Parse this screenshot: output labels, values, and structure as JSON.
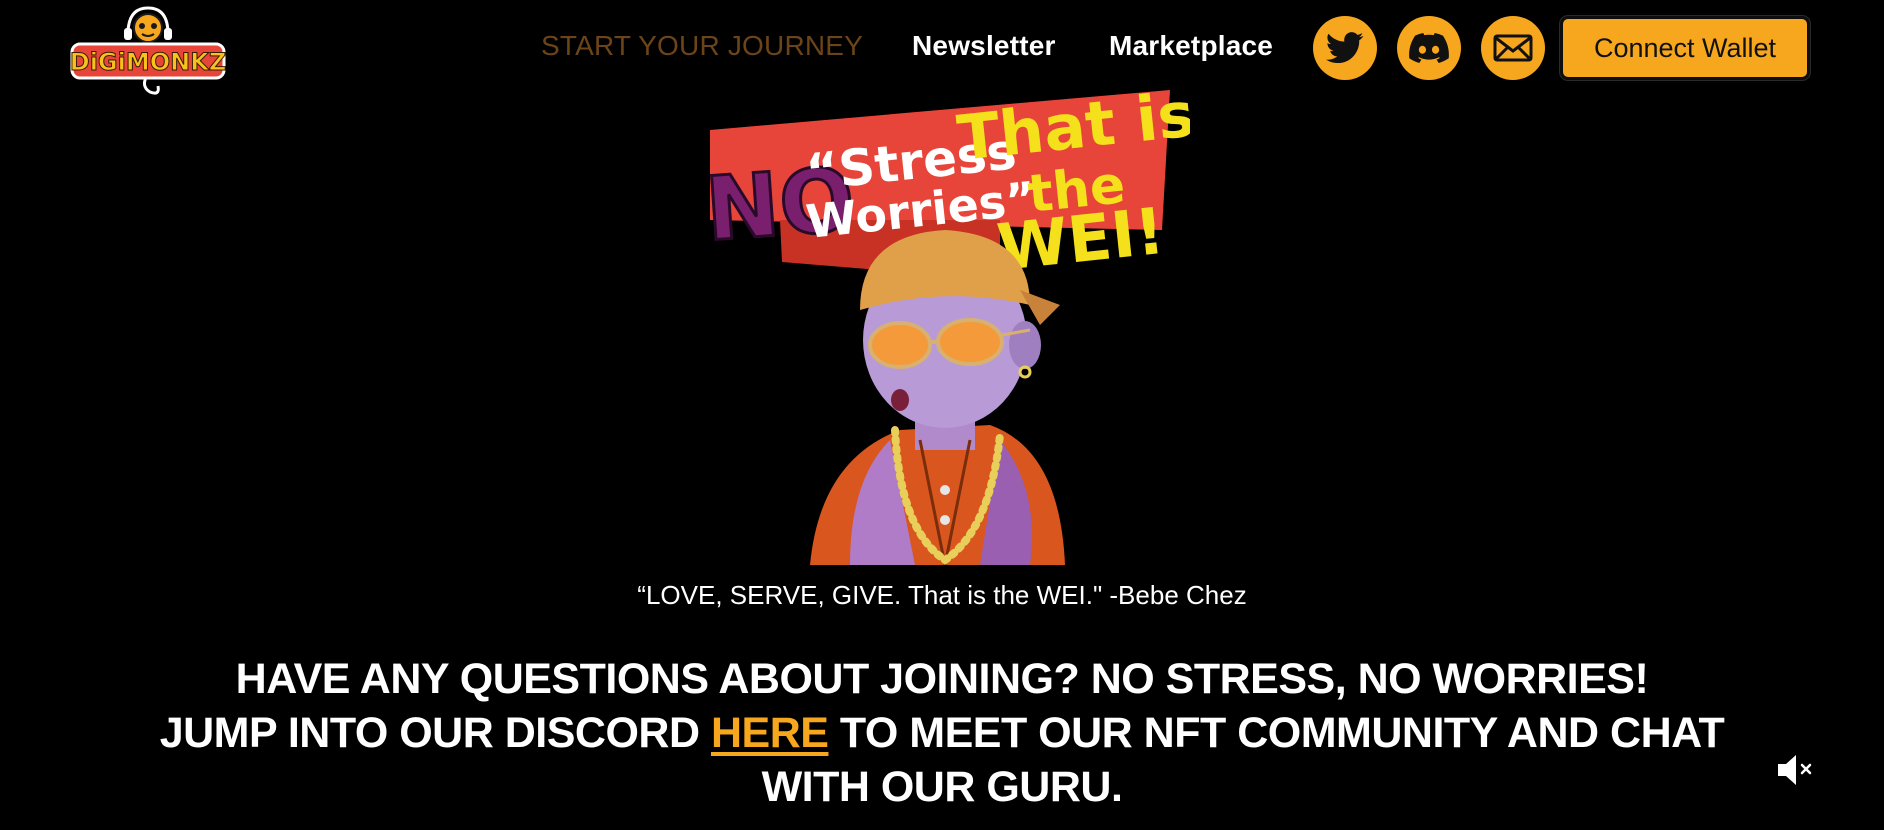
{
  "brand": {
    "logo_text": "DiGiMONKZ"
  },
  "nav": {
    "items": [
      {
        "label": "START YOUR JOURNEY"
      },
      {
        "label": "Newsletter"
      },
      {
        "label": "Marketplace"
      }
    ]
  },
  "social": [
    {
      "icon": "twitter-icon"
    },
    {
      "icon": "discord-icon"
    },
    {
      "icon": "mail-icon"
    }
  ],
  "wallet": {
    "label": "Connect Wallet"
  },
  "hero": {
    "art_text": [
      "NO",
      "“Stress",
      "Worries”",
      "That is",
      "the",
      "WEI!"
    ]
  },
  "quote": "“LOVE, SERVE, GIVE. That is the WEI.\" -Bebe Chez",
  "cta": {
    "line1": "HAVE ANY QUESTIONS ABOUT JOINING? NO STRESS, NO WORRIES!",
    "line2_pre": "JUMP INTO OUR DISCORD ",
    "link": "HERE",
    "line2_post": " TO MEET OUR NFT COMMUNITY AND CHAT",
    "line3": "WITH OUR GURU."
  },
  "audio": {
    "icon": "mute-icon"
  },
  "colors": {
    "accent": "#f7a71d",
    "background": "#000000",
    "banner_red": "#e8453a",
    "art_yellow": "#f5e11b"
  }
}
